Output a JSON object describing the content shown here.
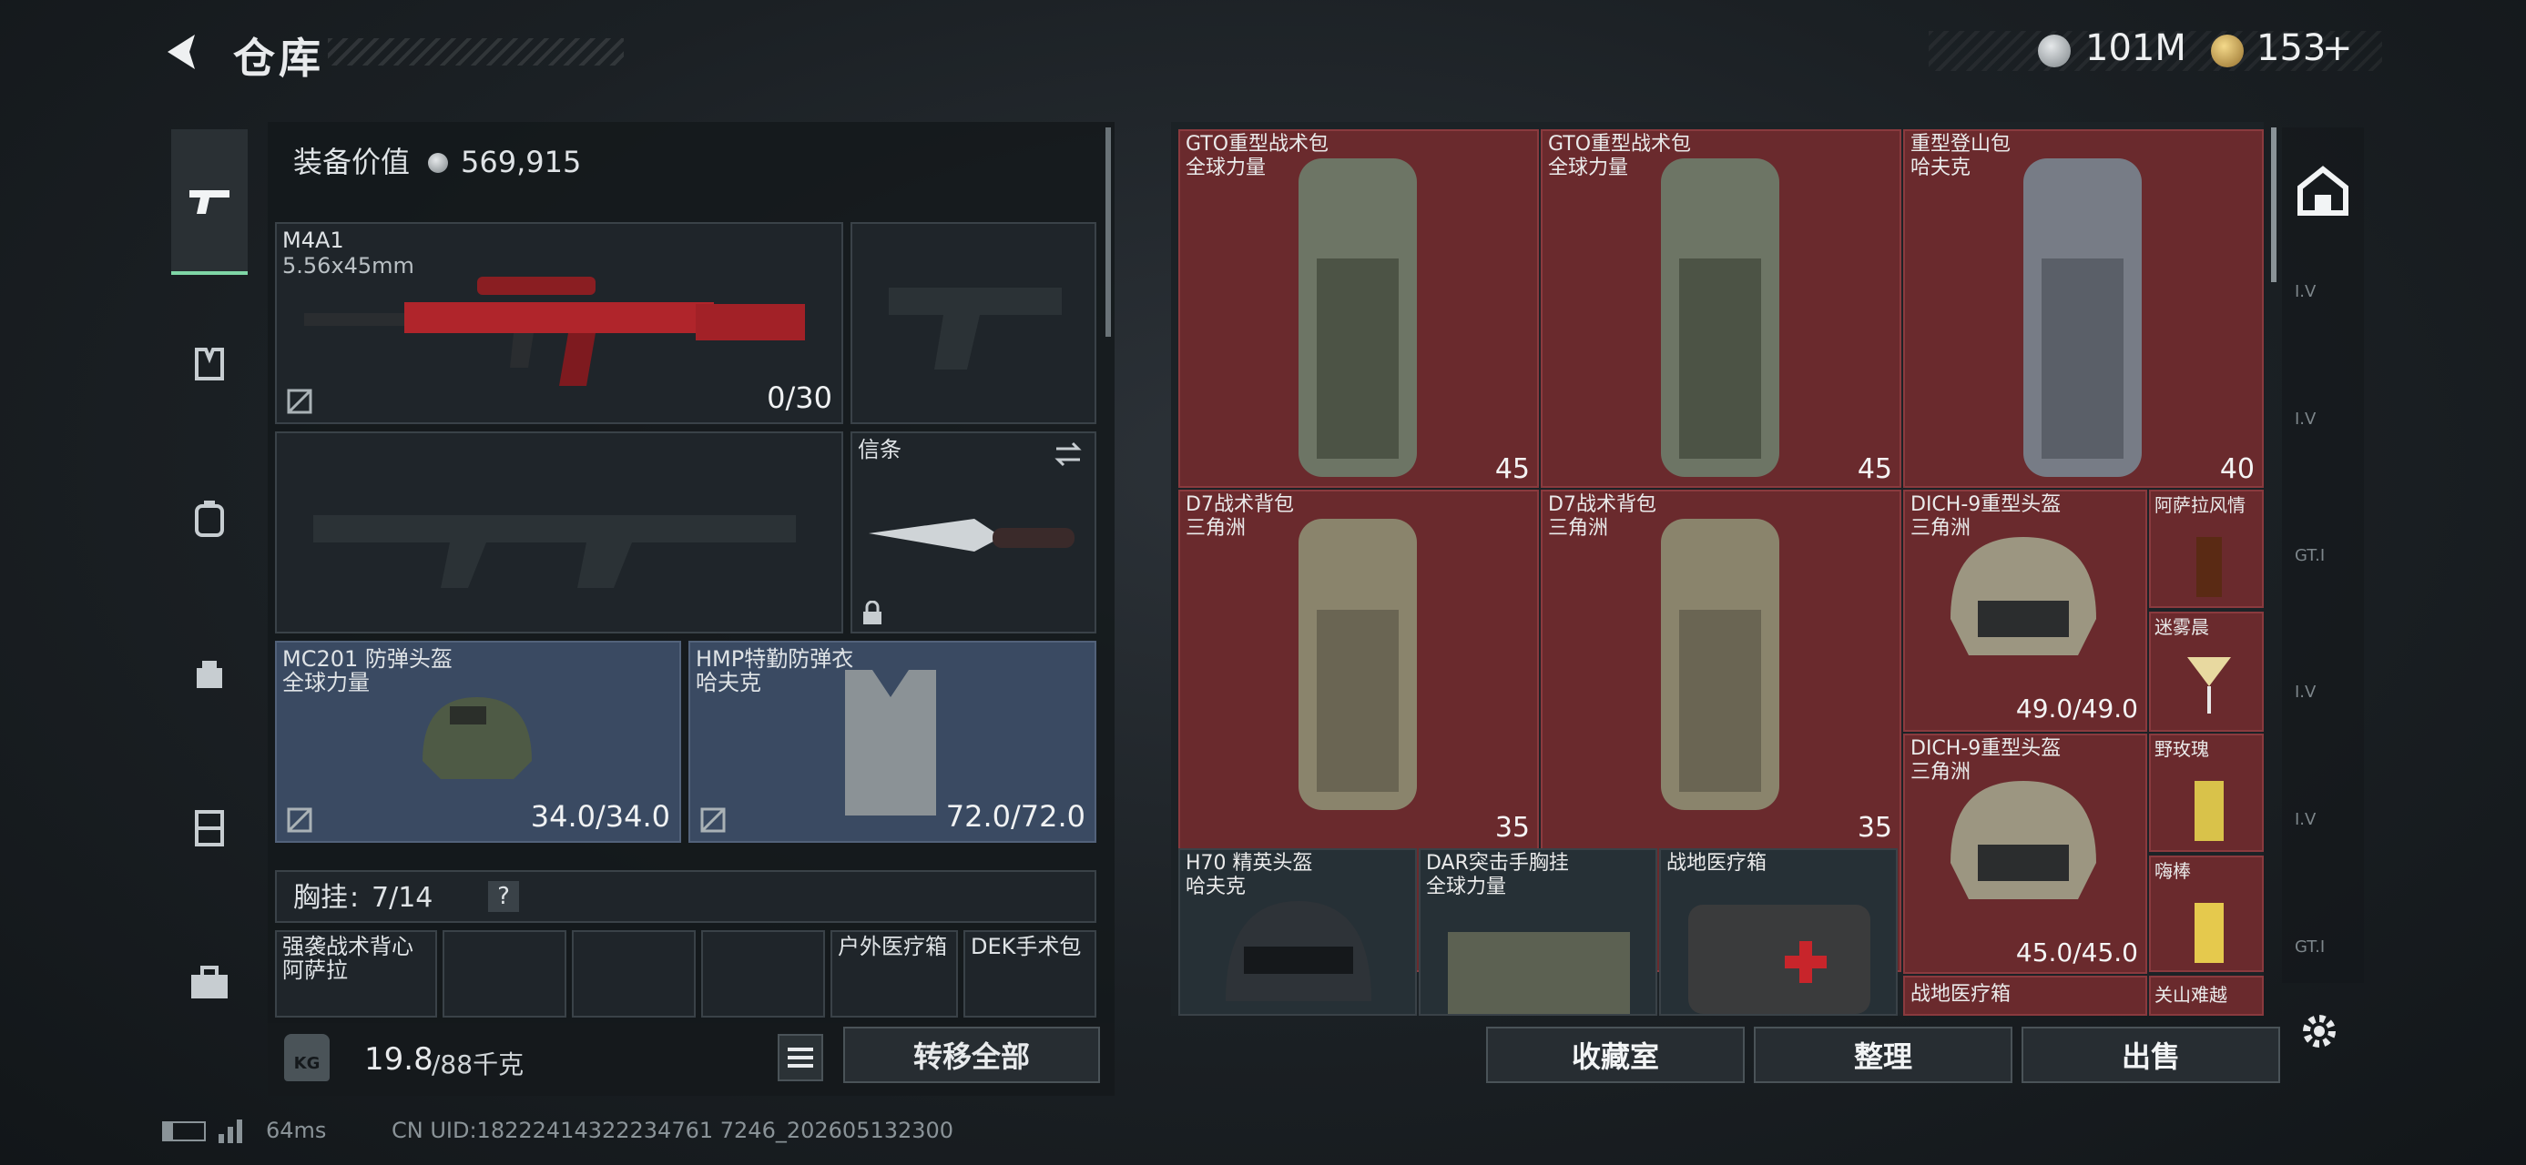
{
  "header": {
    "title": "仓库",
    "currency_silver": "101M",
    "currency_gold": "153",
    "gold_plus": "+"
  },
  "loadout": {
    "value_label": "装备价值",
    "value": "569,915",
    "primary_weapon": {
      "name": "M4A1",
      "caliber": "5.56x45mm",
      "ammo": "0/30"
    },
    "melee": {
      "name": "信条"
    },
    "helmet": {
      "name": "MC201 防弹头盔",
      "faction": "全球力量",
      "durability": "34.0/34.0"
    },
    "armor": {
      "name": "HMP特勤防弹衣",
      "faction": "哈夫克",
      "durability": "72.0/72.0"
    },
    "rig": {
      "label": "胸挂",
      "sep": ":",
      "capacity": "7/14",
      "help": "?"
    },
    "rig_items": [
      {
        "name": "强袭战术背心",
        "faction": "阿萨拉"
      },
      {
        "name": "户外医疗箱"
      },
      {
        "name": "DEK手术包"
      }
    ],
    "weight_icon": "KG",
    "weight": "19.8",
    "weight_max": "/88千克",
    "transfer_all": "转移全部"
  },
  "storage": {
    "items": [
      {
        "name": "GTO重型战术包",
        "faction": "全球力量",
        "qty": "45"
      },
      {
        "name": "GTO重型战术包",
        "faction": "全球力量",
        "qty": "45"
      },
      {
        "name": "重型登山包",
        "faction": "哈夫克",
        "qty": "40"
      },
      {
        "name": "D7战术背包",
        "faction": "三角洲",
        "qty": "35"
      },
      {
        "name": "D7战术背包",
        "faction": "三角洲",
        "qty": "35"
      },
      {
        "name": "DICH-9重型头盔",
        "faction": "三角洲",
        "durability": "49.0/49.0"
      },
      {
        "name": "阿萨拉风情"
      },
      {
        "name": "迷雾晨"
      },
      {
        "name": "DICH-9重型头盔",
        "faction": "三角洲",
        "durability": "45.0/45.0"
      },
      {
        "name": "野玫瑰"
      },
      {
        "name": "嗨棒"
      },
      {
        "name": "H70 精英头盔",
        "faction": "哈夫克"
      },
      {
        "name": "DAR突击手胸挂",
        "faction": "全球力量"
      },
      {
        "name": "战地医疗箱"
      },
      {
        "name": "战地医疗箱"
      },
      {
        "name": "关山难越"
      }
    ],
    "buttons": {
      "collection": "收藏室",
      "organize": "整理",
      "sell": "出售"
    }
  },
  "right_rail": [
    "I.V",
    "I.V",
    "GT.I",
    "I.V",
    "I.V",
    "GT.I"
  ],
  "footer": {
    "latency": "64ms",
    "uid": "CN UID:18222414322234761 7246_202605132300"
  },
  "colors": {
    "accent_green": "#7fd6a6",
    "slot_red": "#6a2a2d",
    "panel_blue": "#3a4a62"
  }
}
